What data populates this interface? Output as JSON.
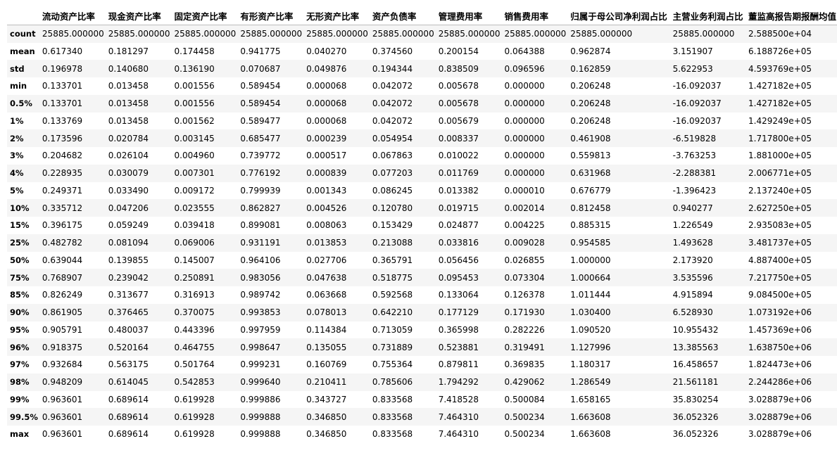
{
  "table": {
    "columns": [
      "流动资产比率",
      "现金资产比率",
      "固定资产比率",
      "有形资产比率",
      "无形资产比率",
      "资产负债率",
      "管理费用率",
      "销售费用率",
      "归属于母公司净利润占比",
      "主营业务利润占比",
      "董监高报告期报酬均值"
    ],
    "rows": [
      {
        "label": "count",
        "cells": [
          "25885.000000",
          "25885.000000",
          "25885.000000",
          "25885.000000",
          "25885.000000",
          "25885.000000",
          "25885.000000",
          "25885.000000",
          "25885.000000",
          "25885.000000",
          "2.588500e+04"
        ]
      },
      {
        "label": "mean",
        "cells": [
          "0.617340",
          "0.181297",
          "0.174458",
          "0.941775",
          "0.040270",
          "0.374560",
          "0.200154",
          "0.064388",
          "0.962874",
          "3.151907",
          "6.188726e+05"
        ]
      },
      {
        "label": "std",
        "cells": [
          "0.196978",
          "0.140680",
          "0.136190",
          "0.070687",
          "0.049876",
          "0.194344",
          "0.838509",
          "0.096596",
          "0.162859",
          "5.622953",
          "4.593769e+05"
        ]
      },
      {
        "label": "min",
        "cells": [
          "0.133701",
          "0.013458",
          "0.001556",
          "0.589454",
          "0.000068",
          "0.042072",
          "0.005678",
          "0.000000",
          "0.206248",
          "-16.092037",
          "1.427182e+05"
        ]
      },
      {
        "label": "0.5%",
        "cells": [
          "0.133701",
          "0.013458",
          "0.001556",
          "0.589454",
          "0.000068",
          "0.042072",
          "0.005678",
          "0.000000",
          "0.206248",
          "-16.092037",
          "1.427182e+05"
        ]
      },
      {
        "label": "1%",
        "cells": [
          "0.133769",
          "0.013458",
          "0.001562",
          "0.589477",
          "0.000068",
          "0.042072",
          "0.005679",
          "0.000000",
          "0.206248",
          "-16.092037",
          "1.429249e+05"
        ]
      },
      {
        "label": "2%",
        "cells": [
          "0.173596",
          "0.020784",
          "0.003145",
          "0.685477",
          "0.000239",
          "0.054954",
          "0.008337",
          "0.000000",
          "0.461908",
          "-6.519828",
          "1.717800e+05"
        ]
      },
      {
        "label": "3%",
        "cells": [
          "0.204682",
          "0.026104",
          "0.004960",
          "0.739772",
          "0.000517",
          "0.067863",
          "0.010022",
          "0.000000",
          "0.559813",
          "-3.763253",
          "1.881000e+05"
        ]
      },
      {
        "label": "4%",
        "cells": [
          "0.228935",
          "0.030079",
          "0.007301",
          "0.776192",
          "0.000839",
          "0.077203",
          "0.011769",
          "0.000000",
          "0.631968",
          "-2.288381",
          "2.006771e+05"
        ]
      },
      {
        "label": "5%",
        "cells": [
          "0.249371",
          "0.033490",
          "0.009172",
          "0.799939",
          "0.001343",
          "0.086245",
          "0.013382",
          "0.000010",
          "0.676779",
          "-1.396423",
          "2.137240e+05"
        ]
      },
      {
        "label": "10%",
        "cells": [
          "0.335712",
          "0.047206",
          "0.023555",
          "0.862827",
          "0.004526",
          "0.120780",
          "0.019715",
          "0.002014",
          "0.812458",
          "0.940277",
          "2.627250e+05"
        ]
      },
      {
        "label": "15%",
        "cells": [
          "0.396175",
          "0.059249",
          "0.039418",
          "0.899081",
          "0.008063",
          "0.153429",
          "0.024877",
          "0.004225",
          "0.885315",
          "1.226549",
          "2.935083e+05"
        ]
      },
      {
        "label": "25%",
        "cells": [
          "0.482782",
          "0.081094",
          "0.069006",
          "0.931191",
          "0.013853",
          "0.213088",
          "0.033816",
          "0.009028",
          "0.954585",
          "1.493628",
          "3.481737e+05"
        ]
      },
      {
        "label": "50%",
        "cells": [
          "0.639044",
          "0.139855",
          "0.145007",
          "0.964106",
          "0.027706",
          "0.365791",
          "0.056456",
          "0.026855",
          "1.000000",
          "2.173920",
          "4.887400e+05"
        ]
      },
      {
        "label": "75%",
        "cells": [
          "0.768907",
          "0.239042",
          "0.250891",
          "0.983056",
          "0.047638",
          "0.518775",
          "0.095453",
          "0.073304",
          "1.000664",
          "3.535596",
          "7.217750e+05"
        ]
      },
      {
        "label": "85%",
        "cells": [
          "0.826249",
          "0.313677",
          "0.316913",
          "0.989742",
          "0.063668",
          "0.592568",
          "0.133064",
          "0.126378",
          "1.011444",
          "4.915894",
          "9.084500e+05"
        ]
      },
      {
        "label": "90%",
        "cells": [
          "0.861905",
          "0.376465",
          "0.370075",
          "0.993853",
          "0.078013",
          "0.642210",
          "0.177129",
          "0.171930",
          "1.030400",
          "6.528930",
          "1.073192e+06"
        ]
      },
      {
        "label": "95%",
        "cells": [
          "0.905791",
          "0.480037",
          "0.443396",
          "0.997959",
          "0.114384",
          "0.713059",
          "0.365998",
          "0.282226",
          "1.090520",
          "10.955432",
          "1.457369e+06"
        ]
      },
      {
        "label": "96%",
        "cells": [
          "0.918375",
          "0.520164",
          "0.464755",
          "0.998647",
          "0.135055",
          "0.731889",
          "0.523881",
          "0.319491",
          "1.127996",
          "13.385563",
          "1.638750e+06"
        ]
      },
      {
        "label": "97%",
        "cells": [
          "0.932684",
          "0.563175",
          "0.501764",
          "0.999231",
          "0.160769",
          "0.755364",
          "0.879811",
          "0.369835",
          "1.180317",
          "16.458657",
          "1.824473e+06"
        ]
      },
      {
        "label": "98%",
        "cells": [
          "0.948209",
          "0.614045",
          "0.542853",
          "0.999640",
          "0.210411",
          "0.785606",
          "1.794292",
          "0.429062",
          "1.286549",
          "21.561181",
          "2.244286e+06"
        ]
      },
      {
        "label": "99%",
        "cells": [
          "0.963601",
          "0.689614",
          "0.619928",
          "0.999886",
          "0.343727",
          "0.833568",
          "7.418528",
          "0.500084",
          "1.658165",
          "35.830254",
          "3.028879e+06"
        ]
      },
      {
        "label": "99.5%",
        "cells": [
          "0.963601",
          "0.689614",
          "0.619928",
          "0.999888",
          "0.346850",
          "0.833568",
          "7.464310",
          "0.500234",
          "1.663608",
          "36.052326",
          "3.028879e+06"
        ]
      },
      {
        "label": "max",
        "cells": [
          "0.963601",
          "0.689614",
          "0.619928",
          "0.999888",
          "0.346850",
          "0.833568",
          "7.464310",
          "0.500234",
          "1.663608",
          "36.052326",
          "3.028879e+06"
        ]
      }
    ]
  }
}
